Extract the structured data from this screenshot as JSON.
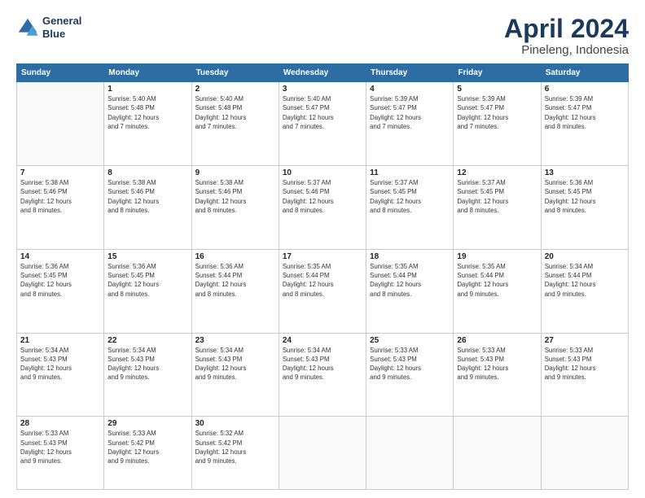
{
  "logo": {
    "line1": "General",
    "line2": "Blue"
  },
  "title": "April 2024",
  "subtitle": "Pineleng, Indonesia",
  "weekdays": [
    "Sunday",
    "Monday",
    "Tuesday",
    "Wednesday",
    "Thursday",
    "Friday",
    "Saturday"
  ],
  "weeks": [
    [
      {
        "day": "",
        "info": ""
      },
      {
        "day": "1",
        "info": "Sunrise: 5:40 AM\nSunset: 5:48 PM\nDaylight: 12 hours\nand 7 minutes."
      },
      {
        "day": "2",
        "info": "Sunrise: 5:40 AM\nSunset: 5:48 PM\nDaylight: 12 hours\nand 7 minutes."
      },
      {
        "day": "3",
        "info": "Sunrise: 5:40 AM\nSunset: 5:47 PM\nDaylight: 12 hours\nand 7 minutes."
      },
      {
        "day": "4",
        "info": "Sunrise: 5:39 AM\nSunset: 5:47 PM\nDaylight: 12 hours\nand 7 minutes."
      },
      {
        "day": "5",
        "info": "Sunrise: 5:39 AM\nSunset: 5:47 PM\nDaylight: 12 hours\nand 7 minutes."
      },
      {
        "day": "6",
        "info": "Sunrise: 5:39 AM\nSunset: 5:47 PM\nDaylight: 12 hours\nand 8 minutes."
      }
    ],
    [
      {
        "day": "7",
        "info": "Sunrise: 5:38 AM\nSunset: 5:46 PM\nDaylight: 12 hours\nand 8 minutes."
      },
      {
        "day": "8",
        "info": "Sunrise: 5:38 AM\nSunset: 5:46 PM\nDaylight: 12 hours\nand 8 minutes."
      },
      {
        "day": "9",
        "info": "Sunrise: 5:38 AM\nSunset: 5:46 PM\nDaylight: 12 hours\nand 8 minutes."
      },
      {
        "day": "10",
        "info": "Sunrise: 5:37 AM\nSunset: 5:46 PM\nDaylight: 12 hours\nand 8 minutes."
      },
      {
        "day": "11",
        "info": "Sunrise: 5:37 AM\nSunset: 5:45 PM\nDaylight: 12 hours\nand 8 minutes."
      },
      {
        "day": "12",
        "info": "Sunrise: 5:37 AM\nSunset: 5:45 PM\nDaylight: 12 hours\nand 8 minutes."
      },
      {
        "day": "13",
        "info": "Sunrise: 5:36 AM\nSunset: 5:45 PM\nDaylight: 12 hours\nand 8 minutes."
      }
    ],
    [
      {
        "day": "14",
        "info": "Sunrise: 5:36 AM\nSunset: 5:45 PM\nDaylight: 12 hours\nand 8 minutes."
      },
      {
        "day": "15",
        "info": "Sunrise: 5:36 AM\nSunset: 5:45 PM\nDaylight: 12 hours\nand 8 minutes."
      },
      {
        "day": "16",
        "info": "Sunrise: 5:36 AM\nSunset: 5:44 PM\nDaylight: 12 hours\nand 8 minutes."
      },
      {
        "day": "17",
        "info": "Sunrise: 5:35 AM\nSunset: 5:44 PM\nDaylight: 12 hours\nand 8 minutes."
      },
      {
        "day": "18",
        "info": "Sunrise: 5:35 AM\nSunset: 5:44 PM\nDaylight: 12 hours\nand 8 minutes."
      },
      {
        "day": "19",
        "info": "Sunrise: 5:35 AM\nSunset: 5:44 PM\nDaylight: 12 hours\nand 9 minutes."
      },
      {
        "day": "20",
        "info": "Sunrise: 5:34 AM\nSunset: 5:44 PM\nDaylight: 12 hours\nand 9 minutes."
      }
    ],
    [
      {
        "day": "21",
        "info": "Sunrise: 5:34 AM\nSunset: 5:43 PM\nDaylight: 12 hours\nand 9 minutes."
      },
      {
        "day": "22",
        "info": "Sunrise: 5:34 AM\nSunset: 5:43 PM\nDaylight: 12 hours\nand 9 minutes."
      },
      {
        "day": "23",
        "info": "Sunrise: 5:34 AM\nSunset: 5:43 PM\nDaylight: 12 hours\nand 9 minutes."
      },
      {
        "day": "24",
        "info": "Sunrise: 5:34 AM\nSunset: 5:43 PM\nDaylight: 12 hours\nand 9 minutes."
      },
      {
        "day": "25",
        "info": "Sunrise: 5:33 AM\nSunset: 5:43 PM\nDaylight: 12 hours\nand 9 minutes."
      },
      {
        "day": "26",
        "info": "Sunrise: 5:33 AM\nSunset: 5:43 PM\nDaylight: 12 hours\nand 9 minutes."
      },
      {
        "day": "27",
        "info": "Sunrise: 5:33 AM\nSunset: 5:43 PM\nDaylight: 12 hours\nand 9 minutes."
      }
    ],
    [
      {
        "day": "28",
        "info": "Sunrise: 5:33 AM\nSunset: 5:43 PM\nDaylight: 12 hours\nand 9 minutes."
      },
      {
        "day": "29",
        "info": "Sunrise: 5:33 AM\nSunset: 5:42 PM\nDaylight: 12 hours\nand 9 minutes."
      },
      {
        "day": "30",
        "info": "Sunrise: 5:32 AM\nSunset: 5:42 PM\nDaylight: 12 hours\nand 9 minutes."
      },
      {
        "day": "",
        "info": ""
      },
      {
        "day": "",
        "info": ""
      },
      {
        "day": "",
        "info": ""
      },
      {
        "day": "",
        "info": ""
      }
    ]
  ]
}
